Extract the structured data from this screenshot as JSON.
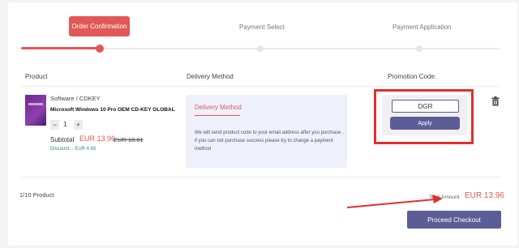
{
  "steps": {
    "step1": "Order Confirmation",
    "step2": "Payment Select",
    "step3": "Payment Application"
  },
  "headers": {
    "product": "Product",
    "delivery": "Delivery Method",
    "promotion": "Promotion Code:"
  },
  "product": {
    "category": "Software / CDKEY",
    "name": "Microsoft Windows 10 Pro OEM CD-KEY GLOBAL",
    "qty_minus": "−",
    "qty_value": "1",
    "qty_plus": "+",
    "subtotal_label": "Subtotal",
    "subtotal_price": "EUR 13.96",
    "original_price": "EUR 18.61",
    "discount": "Discount: - EUR 4.65"
  },
  "delivery": {
    "title": "Delivery Method",
    "text": "We will send product code to your email address after you purchase , if you can not purchase success please try to change a payment method"
  },
  "promo": {
    "code_value": "DGR",
    "apply_label": "Apply"
  },
  "footer": {
    "count": "1/10 Product",
    "total_label": "Total Amount",
    "total_value": "EUR 13.96",
    "checkout_label": "Proceed Checkout"
  },
  "colors": {
    "accent": "#e25858",
    "brand": "#5b5e96",
    "annotation": "#e0302f"
  },
  "icons": {
    "delete": "trash-icon"
  }
}
